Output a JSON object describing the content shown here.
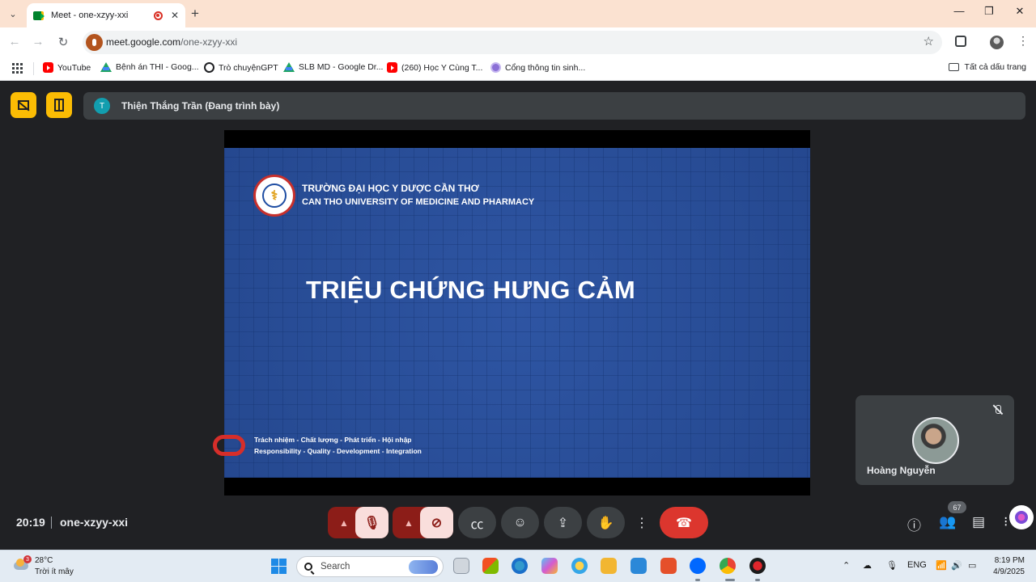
{
  "browser": {
    "tab_title": "Meet - one-xzyy-xxi",
    "url_host": "meet.google.com",
    "url_path": "/one-xzyy-xxi",
    "bookmarks": [
      {
        "label": "YouTube",
        "icon": "youtube-icon"
      },
      {
        "label": "Bệnh án THI - Goog...",
        "icon": "drive-icon"
      },
      {
        "label": "Trò chuyệnGPT",
        "icon": "chatgpt-icon"
      },
      {
        "label": "SLB MD - Google Dr...",
        "icon": "drive-icon"
      },
      {
        "label": "(260) Học Y Cùng T...",
        "icon": "youtube-icon"
      },
      {
        "label": "Cổng thông tin sinh...",
        "icon": "portal-icon"
      }
    ],
    "all_bookmarks_label": "Tất cả dấu trang"
  },
  "meet": {
    "presenter_initial": "T",
    "presenter_label": "Thiện Thắng Trần (Đang trình bày)",
    "slide": {
      "university_vi": "TRƯỜNG ĐẠI HỌC Y DƯỢC CẦN THƠ",
      "university_en": "CAN THO UNIVERSITY OF MEDICINE AND PHARMACY",
      "title": "TRIỆU CHỨNG HƯNG CẢM",
      "motto_vi": "Trách nhiệm - Chất lượng - Phát triển - Hội nhập",
      "motto_en": "Responsibility - Quality - Development - Integration"
    },
    "self_tile_name": "Hoàng Nguyễn",
    "time": "20:19",
    "meeting_code": "one-xzyy-xxi",
    "participants_count": "67",
    "colors": {
      "end_call": "#dc362e",
      "muted_bg": "#f9dedc",
      "accent_yellow": "#fbbc04"
    }
  },
  "taskbar": {
    "weather_badge": "3",
    "temperature": "28°C",
    "weather_desc": "Trời ít mây",
    "search_placeholder": "Search",
    "language": "ENG",
    "time": "8:19 PM",
    "date": "4/9/2025"
  }
}
